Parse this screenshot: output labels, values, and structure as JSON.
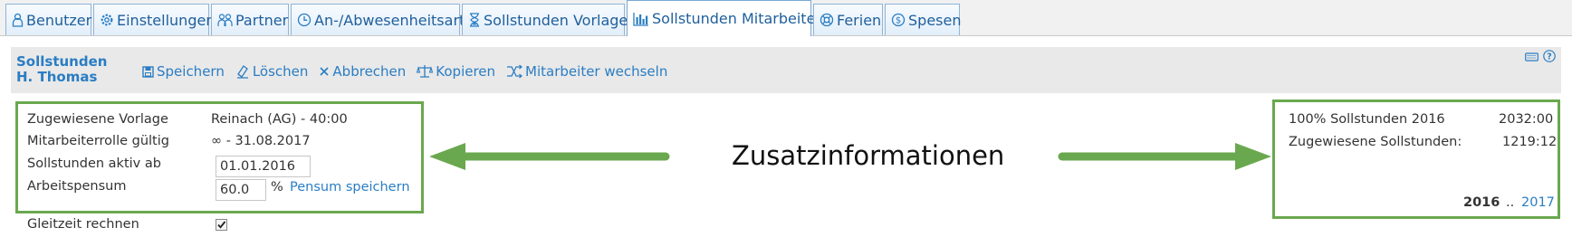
{
  "tabs": [
    {
      "label": "Benutzer",
      "icon": "user-icon"
    },
    {
      "label": "Einstellungen",
      "icon": "gear-icon"
    },
    {
      "label": "Partner",
      "icon": "partner-icon"
    },
    {
      "label": "An-/Abwesenheitsart",
      "icon": "clock-icon"
    },
    {
      "label": "Sollstunden Vorlage",
      "icon": "hourglass-icon"
    },
    {
      "label": "Sollstunden Mitarbeiter",
      "icon": "bar-chart-icon",
      "active": true
    },
    {
      "label": "Ferien",
      "icon": "lifebuoy-icon"
    },
    {
      "label": "Spesen",
      "icon": "money-icon"
    }
  ],
  "header": {
    "title_line1": "Sollstunden",
    "title_line2": "H. Thomas"
  },
  "toolbar": {
    "save": "Speichern",
    "delete": "Löschen",
    "cancel": "Abbrechen",
    "copy": "Kopieren",
    "switch": "Mitarbeiter wechseln"
  },
  "info": {
    "template_label": "Zugewiesene Vorlage",
    "template_value": "Reinach (AG) - 40:00",
    "role_label": "Mitarbeiterrolle gültig",
    "role_value": "∞ - 31.08.2017",
    "active_label": "Sollstunden aktiv ab",
    "active_value": "01.01.2016",
    "workload_label": "Arbeitspensum",
    "workload_value": "60.0",
    "workload_unit": "%",
    "workload_save": "Pensum speichern"
  },
  "annotation": "Zusatzinformationen",
  "summary": {
    "full_label": "100% Sollstunden 2016",
    "full_value": "2032:00",
    "assigned_label": "Zugewiesene Sollstunden:",
    "assigned_value": "1219:12",
    "year_current": "2016",
    "year_sep": "..",
    "year_next": "2017"
  },
  "flextime": {
    "label": "Gleitzeit rechnen",
    "checked": true
  },
  "colors": {
    "accent": "#2a7dc3",
    "highlight_green": "#6aa84f",
    "header_bg": "#e9e9e9"
  }
}
